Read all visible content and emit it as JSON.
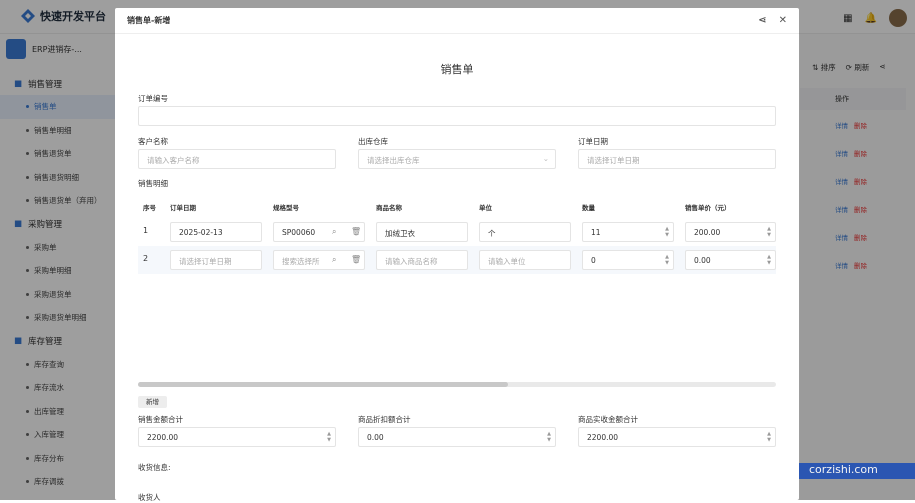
{
  "app": {
    "brand": "快速开发平台",
    "app_name": "ERP进销存-..."
  },
  "sidebar": {
    "groups": [
      {
        "label": "销售管理",
        "items": [
          "销售单",
          "销售单明细",
          "销售退货单",
          "销售退货明细",
          "销售退货单（弃用）"
        ]
      },
      {
        "label": "采购管理",
        "items": [
          "采购单",
          "采购单明细",
          "采购退货单",
          "采购退货单明细"
        ]
      },
      {
        "label": "库存管理",
        "items": [
          "库存查询",
          "库存流水",
          "出库管理",
          "入库管理",
          "库存分布",
          "库存调拨"
        ]
      }
    ]
  },
  "background": {
    "sort_label": "排序",
    "refresh_label": "刷新",
    "op_header": "操作",
    "detail": "详情",
    "delete": "删除"
  },
  "modal": {
    "header_title": "销售单-新增",
    "title": "销售单",
    "order_no_label": "订单编号",
    "customer_label": "客户名称",
    "customer_placeholder": "请输入客户名称",
    "warehouse_label": "出库仓库",
    "warehouse_placeholder": "请选择出库仓库",
    "order_date_label": "订单日期",
    "order_date_placeholder": "请选择订单日期",
    "detail_label": "销售明细",
    "columns": [
      "序号",
      "订单日期",
      "规格型号",
      "商品名称",
      "单位",
      "数量",
      "销售单价（元）"
    ],
    "rows": [
      {
        "no": "1",
        "date": "2025-02-13",
        "spec": "SP00060",
        "name": "加绒卫衣",
        "unit": "个",
        "qty": "11",
        "price": "200.00"
      },
      {
        "no": "2",
        "date": "请选择订单日期",
        "spec": "搜索选择所",
        "name": "请输入商品名称",
        "unit": "请输入单位",
        "qty": "0",
        "price": "0.00"
      }
    ],
    "add_label": "新增",
    "sales_total_label": "销售金额合计",
    "sales_total": "2200.00",
    "discount_label": "商品折扣额合计",
    "discount": "0.00",
    "received_label": "商品实收金额合计",
    "received": "2200.00",
    "receipt_label": "收货信息:",
    "receiver_label": "收货人"
  },
  "watermark": "corzishi.com"
}
